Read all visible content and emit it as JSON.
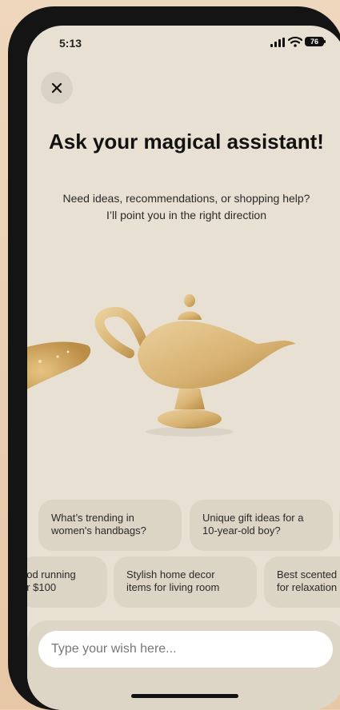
{
  "status_bar": {
    "time": "5:13",
    "battery": "76"
  },
  "header": {
    "title": "Ask your magical assistant!",
    "subtitle": "Need ideas, recommendations, or shopping help?\nI’ll point you in the right direction"
  },
  "suggestions": {
    "row1": [
      {
        "label": "What’s trending in\nwomen's handbags?"
      },
      {
        "label": "Unique gift ideas for a\n10-year-old boy?"
      }
    ],
    "row2": [
      {
        "label": "ood running\ner $100"
      },
      {
        "label": "Stylish home decor\nitems for living room"
      },
      {
        "label": "Best scented\nfor relaxation"
      }
    ]
  },
  "input": {
    "placeholder": "Type your wish here..."
  },
  "colors": {
    "screen_bg": "#e8e1d3",
    "chip_bg": "#dcd4c5",
    "lamp_gold": "#d9b57a"
  }
}
